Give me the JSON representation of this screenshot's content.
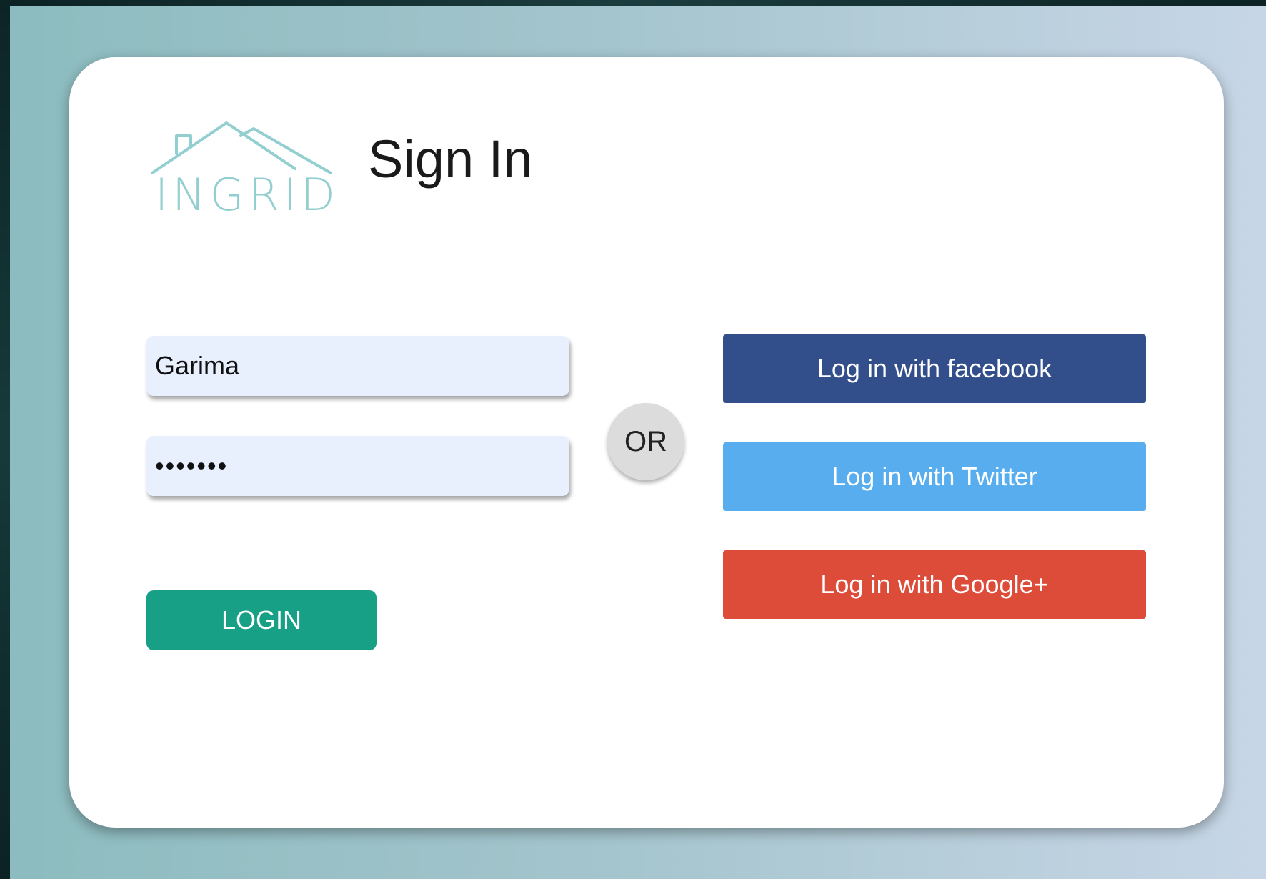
{
  "brand": {
    "logo_text": "INGRID",
    "logo_color": "#93cfd0"
  },
  "page": {
    "title": "Sign In"
  },
  "form": {
    "username_value": "Garima",
    "password_value": "•••••••",
    "login_label": "LOGIN",
    "login_color": "#17a085"
  },
  "divider": {
    "or_label": "OR"
  },
  "social": {
    "facebook_label": "Log in with facebook",
    "facebook_color": "#324f8c",
    "twitter_label": "Log in with Twitter",
    "twitter_color": "#57adee",
    "google_label": "Log in with Google+",
    "google_color": "#dd4b39"
  },
  "colors": {
    "card": "#ffffff",
    "field_bg": "#e8effd",
    "background_start": "#8cbcbf",
    "background_end": "#c7d6e6"
  }
}
